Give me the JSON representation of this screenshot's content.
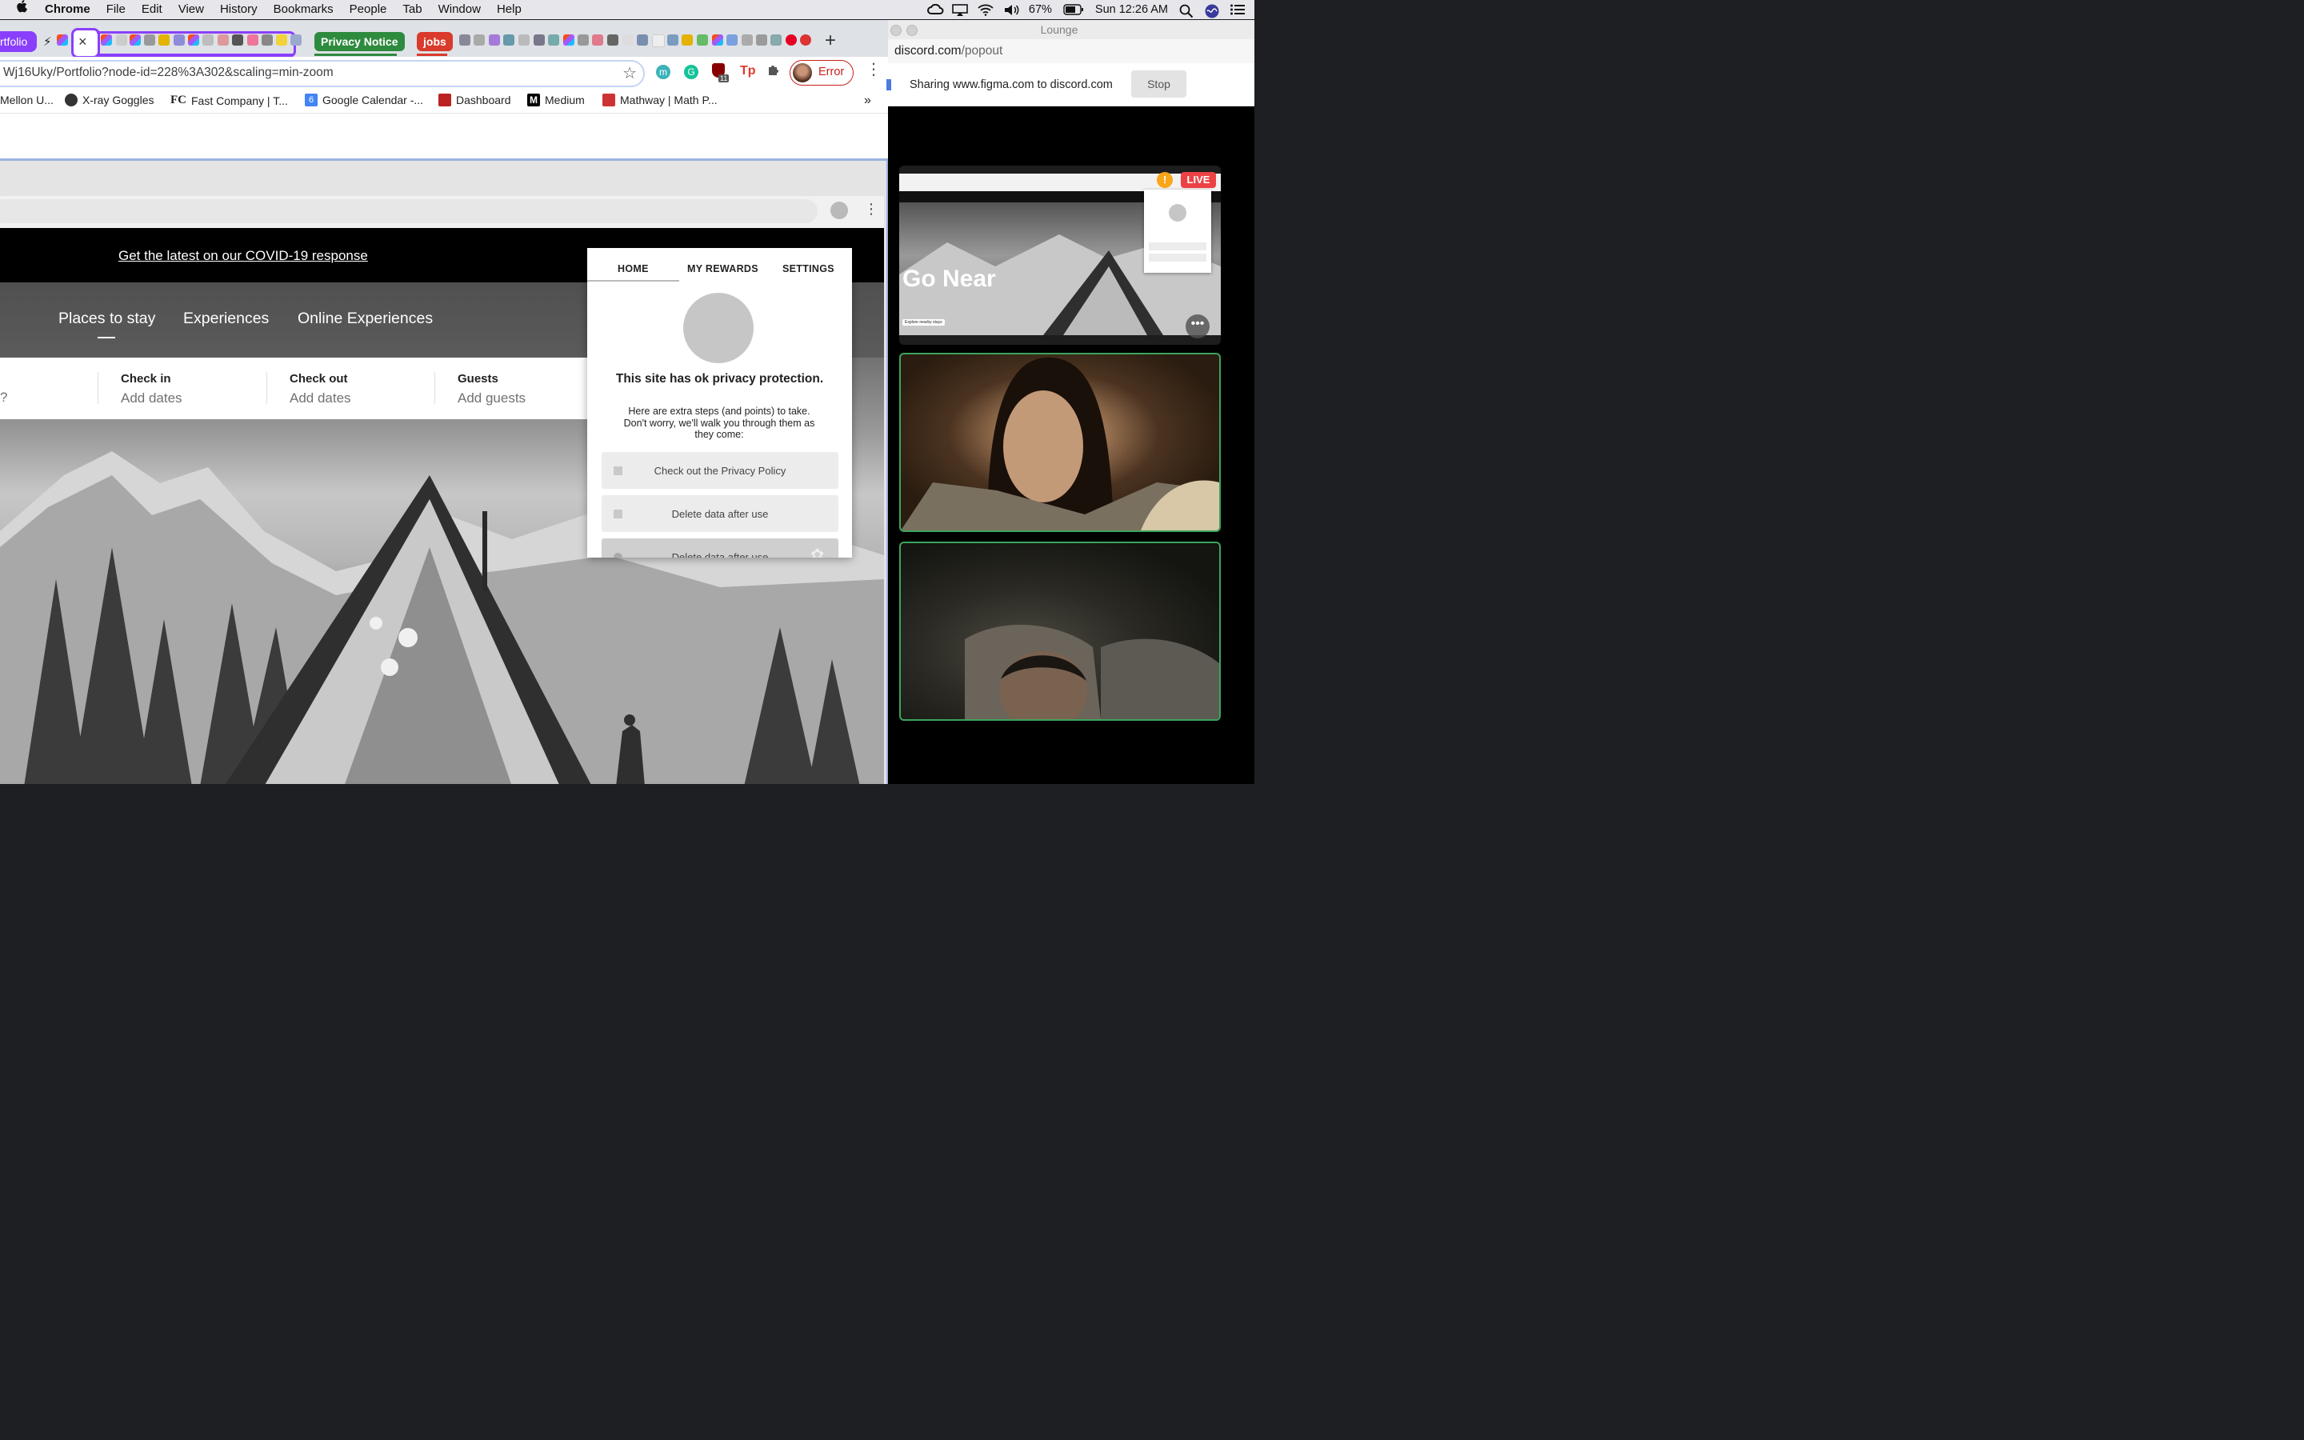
{
  "menubar": {
    "app": "Chrome",
    "items": [
      "File",
      "Edit",
      "View",
      "History",
      "Bookmarks",
      "People",
      "Tab",
      "Window",
      "Help"
    ],
    "battery": "67%",
    "clock": "Sun 12:26 AM"
  },
  "chrome": {
    "tabs": {
      "first_tab_label": "rtfolio",
      "close_glyph": "×",
      "privacy_pill": "Privacy Notice",
      "jobs_pill": "jobs",
      "new_tab": "+"
    },
    "url": "Wj16Uky/Portfolio?node-id=228%3A302&scaling=min-zoom",
    "toolbar": {
      "ext_badge": "11",
      "ext_tp": "Tp",
      "profile_status": "Error"
    },
    "bookmarks": [
      "Mellon U...",
      "X-ray Goggles",
      "Fast Company | T...",
      "Google Calendar -...",
      "Dashboard",
      "Medium",
      "Mathway | Math P..."
    ],
    "bookmark_icon_letters": {
      "fast_company": "FC",
      "calendar": "6",
      "medium": "M"
    },
    "bookmarks_overflow": "»"
  },
  "airbnb": {
    "covid_link": "Get the latest on our COVID-19 response",
    "nav": [
      "Places to stay",
      "Experiences",
      "Online Experiences"
    ],
    "search": {
      "location_partial": "?",
      "checkin_label": "Check in",
      "checkin_value": "Add dates",
      "checkout_label": "Check out",
      "checkout_value": "Add dates",
      "guests_label": "Guests",
      "guests_value": "Add guests"
    }
  },
  "extension": {
    "tabs": [
      "HOME",
      "MY REWARDS",
      "SETTINGS"
    ],
    "title": "This site has ok privacy protection.",
    "subtitle": "Here are extra steps (and points) to take. Don't worry, we'll walk you through them as they come:",
    "tasks": [
      "Check out the Privacy Policy",
      "Delete data after use",
      "Delete data after use"
    ]
  },
  "discord": {
    "window_title": "Lounge",
    "url_domain": "discord.com",
    "url_path": "/popout",
    "share_text": "Sharing www.figma.com to discord.com",
    "stop_label": "Stop",
    "live_label": "LIVE",
    "warn_label": "!",
    "stream_overlay": "Go Near",
    "stream_button": "Explore nearby stays"
  },
  "colors": {
    "accent_purple": "#8a3ffc",
    "privacy_green": "#2e8b3e",
    "jobs_red": "#d93a2b",
    "live_red": "#ed4245",
    "speaking_green": "#3ba55c",
    "profile_error": "#c5221f"
  }
}
